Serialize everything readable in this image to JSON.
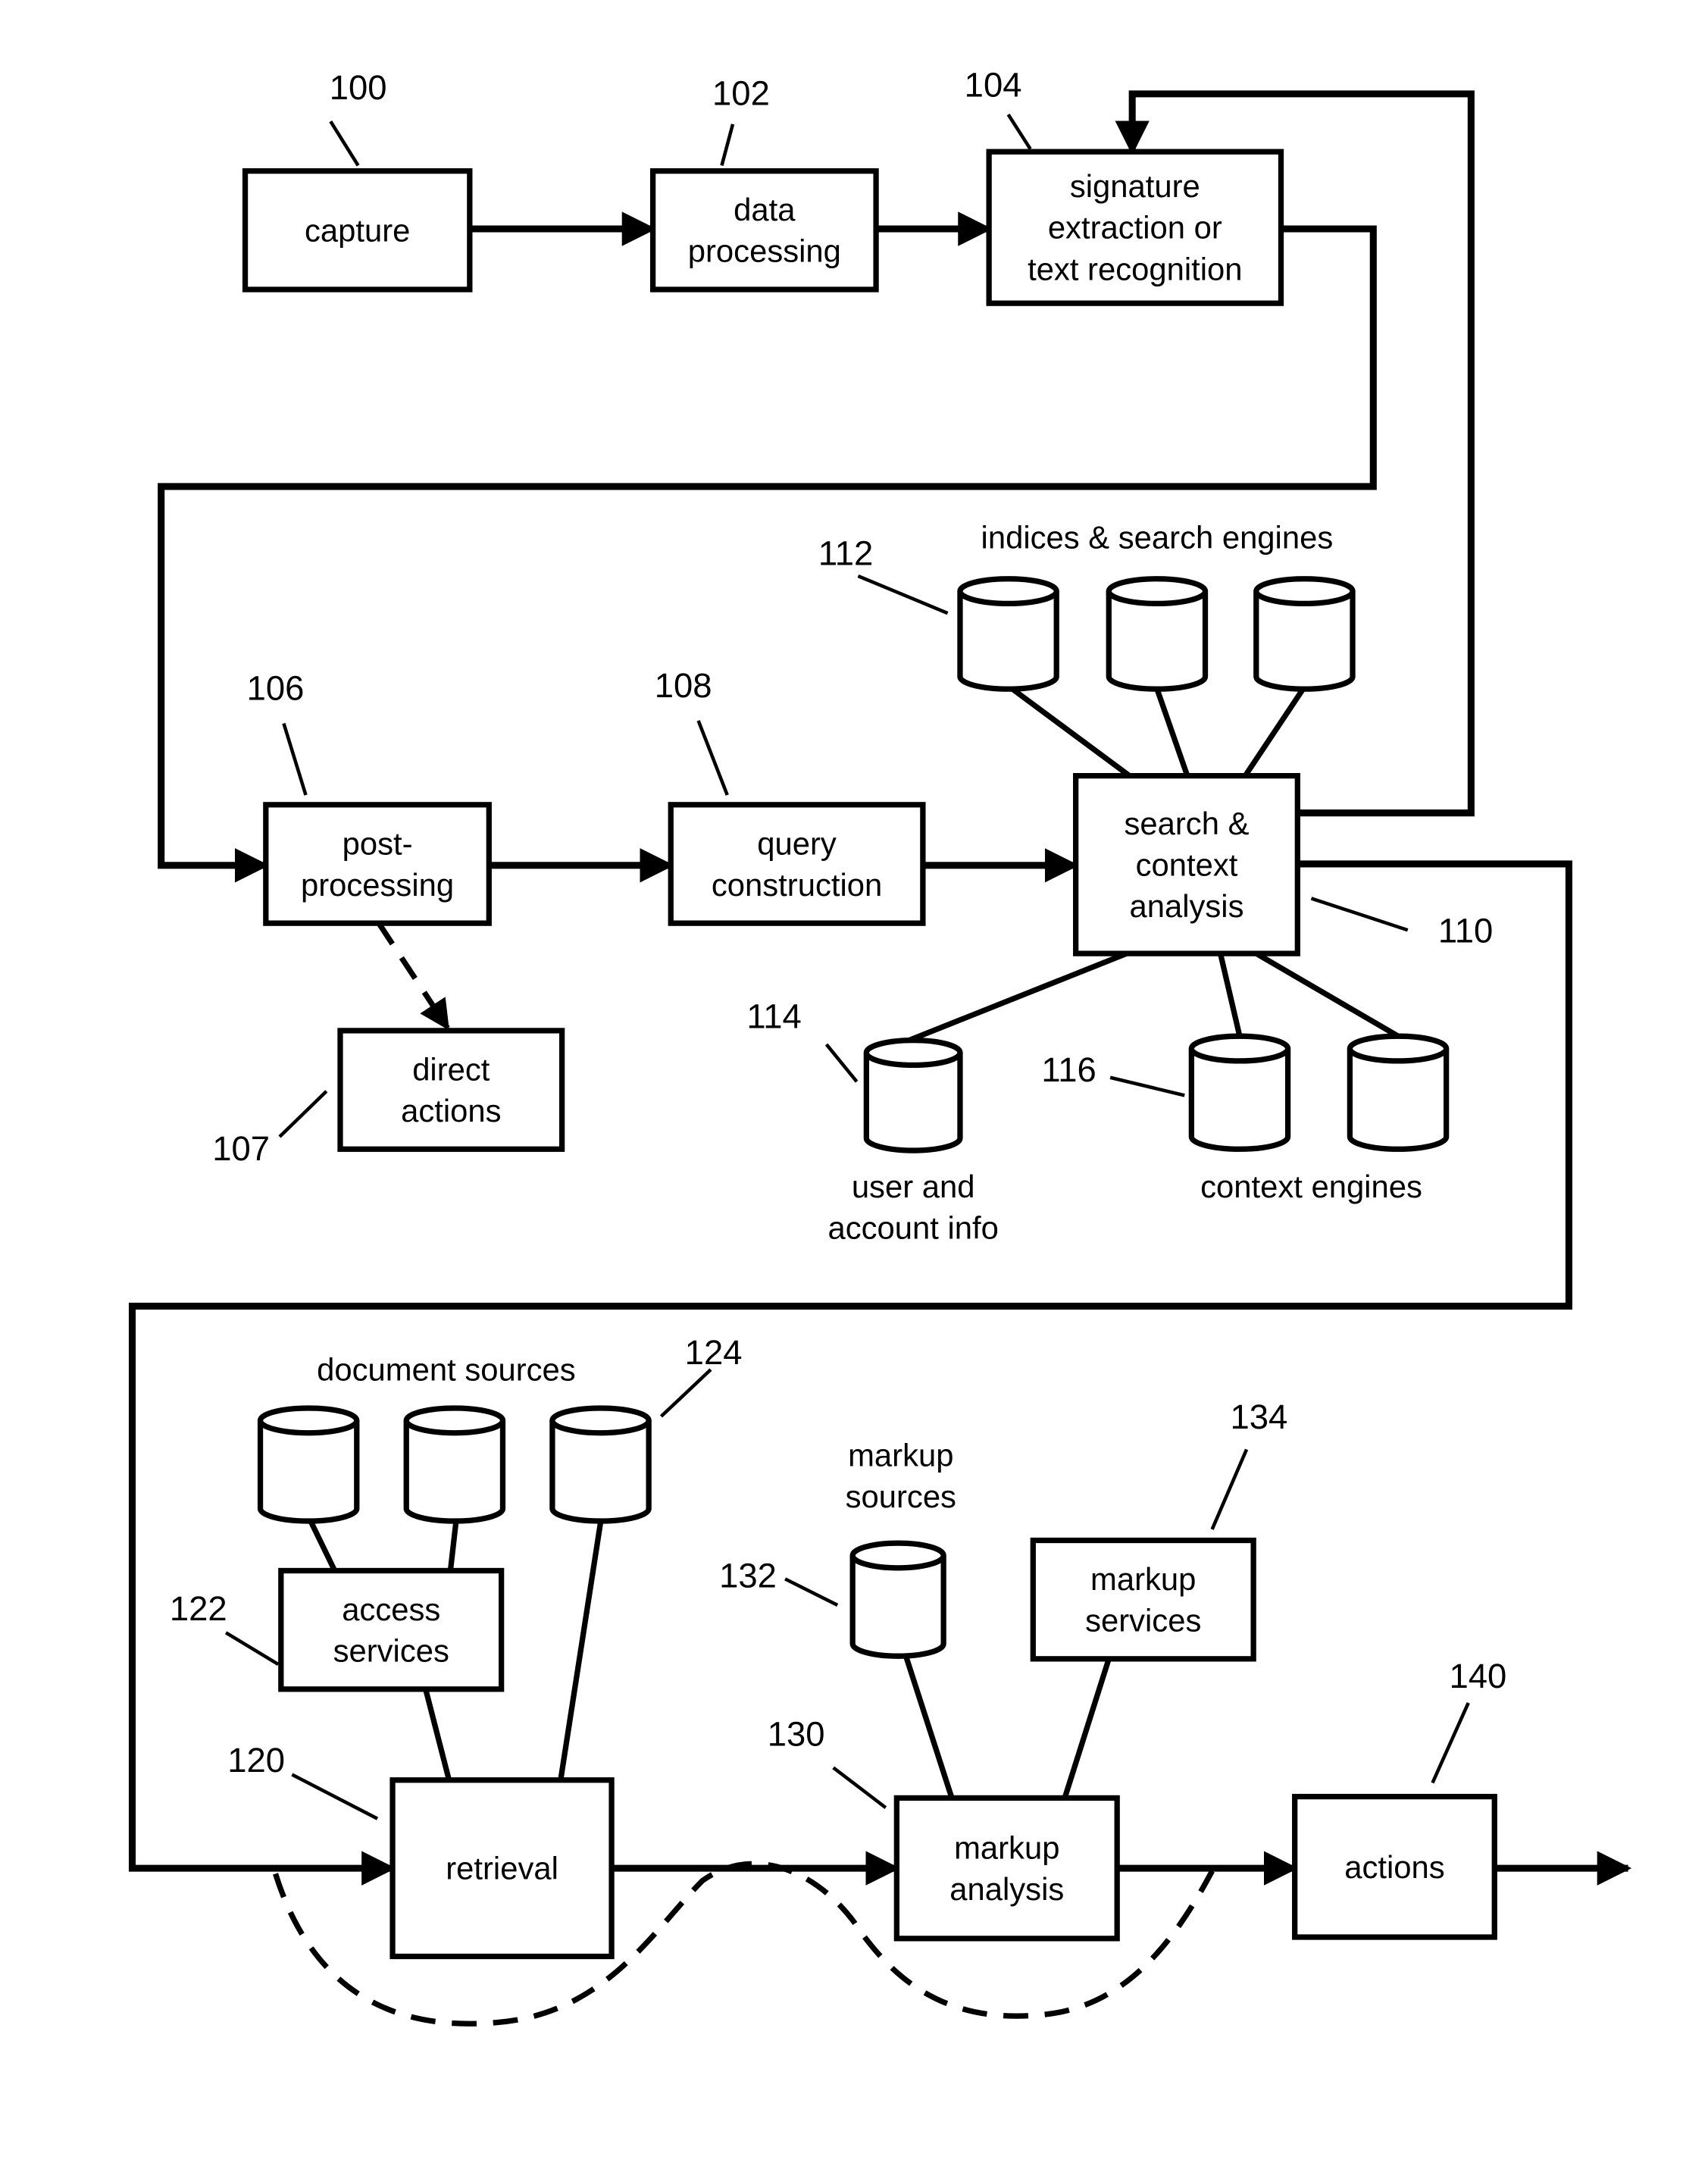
{
  "figure": {
    "blocks": [
      {
        "id": "capture",
        "ref": "100",
        "lines": [
          "capture"
        ]
      },
      {
        "id": "data-processing",
        "ref": "102",
        "lines": [
          "data",
          "processing"
        ]
      },
      {
        "id": "signature-extraction",
        "ref": "104",
        "lines": [
          "signature",
          "extraction or",
          "text recognition"
        ]
      },
      {
        "id": "post-processing",
        "ref": "106",
        "lines": [
          "post-",
          "processing"
        ]
      },
      {
        "id": "direct-actions",
        "ref": "107",
        "lines": [
          "direct",
          "actions"
        ]
      },
      {
        "id": "query-construction",
        "ref": "108",
        "lines": [
          "query",
          "construction"
        ]
      },
      {
        "id": "search-context-analysis",
        "ref": "110",
        "lines": [
          "search &",
          "context",
          "analysis"
        ]
      },
      {
        "id": "retrieval",
        "ref": "120",
        "lines": [
          "retrieval"
        ]
      },
      {
        "id": "access-services",
        "ref": "122",
        "lines": [
          "access",
          "services"
        ]
      },
      {
        "id": "markup-analysis",
        "ref": "130",
        "lines": [
          "markup",
          "analysis"
        ]
      },
      {
        "id": "markup-services",
        "ref": "134",
        "lines": [
          "markup",
          "services"
        ]
      },
      {
        "id": "actions",
        "ref": "140",
        "lines": [
          "actions"
        ]
      }
    ],
    "stores": [
      {
        "id": "indices",
        "ref": "112",
        "caption": [
          "indices & search engines"
        ],
        "count": 3
      },
      {
        "id": "user-account",
        "ref": "114",
        "caption": [
          "user and",
          "account info"
        ],
        "count": 1
      },
      {
        "id": "context-engines",
        "ref": "116",
        "caption": [
          "context engines"
        ],
        "count": 2
      },
      {
        "id": "document-sources",
        "ref": "124",
        "caption": [
          "document sources"
        ],
        "count": 3
      },
      {
        "id": "markup-sources",
        "ref": "132",
        "caption": [
          "markup",
          "sources"
        ],
        "count": 1
      }
    ]
  }
}
